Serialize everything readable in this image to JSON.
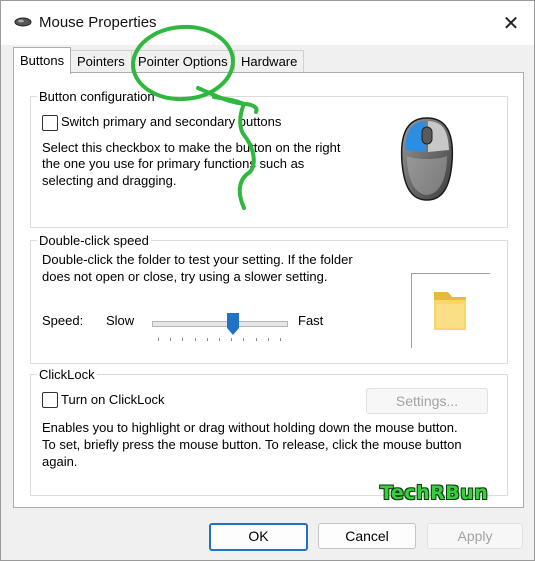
{
  "window": {
    "title": "Mouse Properties",
    "close_glyph": "✕"
  },
  "tabs": [
    {
      "label": "Buttons",
      "active": true
    },
    {
      "label": "Pointers",
      "active": false
    },
    {
      "label": "Pointer Options",
      "active": false
    },
    {
      "label": "Hardware",
      "active": false
    }
  ],
  "button_configuration": {
    "title": "Button configuration",
    "checkbox_label": "Switch primary and secondary buttons",
    "checked": false,
    "description_lines": [
      "Select this checkbox to make the button on the right",
      "the one you use for primary functions such as",
      "selecting and dragging."
    ]
  },
  "double_click": {
    "title": "Double-click speed",
    "description_lines": [
      "Double-click the folder to test your setting. If the folder",
      "does not open or close, try using a slower setting."
    ],
    "speed_label": "Speed:",
    "slow_label": "Slow",
    "fast_label": "Fast",
    "slider_value": 0.6,
    "tick_count": 11
  },
  "clicklock": {
    "title": "ClickLock",
    "checkbox_label": "Turn on ClickLock",
    "checked": false,
    "settings_button": "Settings...",
    "description_lines": [
      "Enables you to highlight or drag without holding down the mouse button.",
      "To set, briefly press the mouse button. To release, click the mouse button",
      "again."
    ]
  },
  "footer": {
    "ok": "OK",
    "cancel": "Cancel",
    "apply": "Apply"
  },
  "watermark": "TechRBun",
  "colors": {
    "accent": "#1f72c8",
    "annotation": "#2fb83d",
    "watermark": "#35d03a"
  }
}
